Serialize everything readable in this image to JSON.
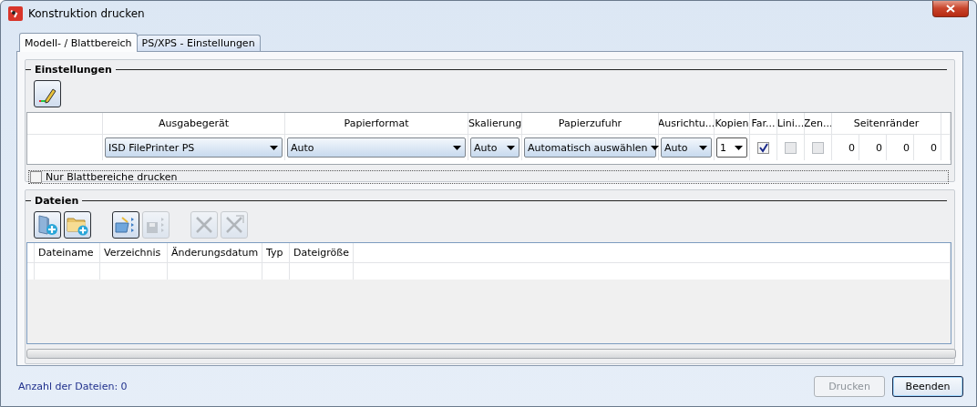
{
  "window": {
    "title": "Konstruktion drucken"
  },
  "tabs": [
    {
      "label": "Modell- / Blattbereich",
      "selected": true
    },
    {
      "label": "PS/XPS - Einstellungen",
      "selected": false
    }
  ],
  "settings": {
    "title": "Einstellungen",
    "columns": [
      "Ausgabegerät",
      "Papierformat",
      "Skalierung",
      "Papierzufuhr",
      "Ausrichtu...",
      "Kopien",
      "Far...",
      "Lini...",
      "Zen...",
      "Seitenränder"
    ],
    "cells": [
      {
        "kind": "dropdown",
        "value": "ISD FilePrinter PS"
      },
      {
        "kind": "dropdown",
        "value": "Auto"
      },
      {
        "kind": "dropdown",
        "value": "Auto"
      },
      {
        "kind": "dropdown",
        "value": "Automatisch auswählen"
      },
      {
        "kind": "dropdown",
        "value": "Auto"
      },
      {
        "kind": "combo",
        "value": "1"
      },
      {
        "kind": "checkbox",
        "checked": true,
        "disabled": false
      },
      {
        "kind": "checkbox",
        "checked": false,
        "disabled": true
      },
      {
        "kind": "checkbox",
        "checked": false,
        "disabled": true
      },
      {
        "kind": "number",
        "value": "0"
      },
      {
        "kind": "number",
        "value": "0"
      },
      {
        "kind": "number",
        "value": "0"
      },
      {
        "kind": "number",
        "value": "0"
      }
    ],
    "sheet_only": {
      "label": "Nur Blattbereiche drucken",
      "checked": false
    }
  },
  "files": {
    "title": "Dateien",
    "toolbar": [
      [
        {
          "kind": "add-file",
          "disabled": false
        },
        {
          "kind": "add-folder",
          "disabled": false
        }
      ],
      [
        {
          "kind": "open-list",
          "disabled": false
        },
        {
          "kind": "save-list",
          "disabled": true
        }
      ],
      [
        {
          "kind": "remove",
          "disabled": true
        },
        {
          "kind": "remove-all",
          "disabled": true
        }
      ]
    ],
    "columns": [
      "Dateiname",
      "Verzeichnis",
      "Änderungsdatum",
      "Typ",
      "Dateigröße"
    ]
  },
  "status": "Anzahl der Dateien: 0",
  "buttons": [
    {
      "label": "Drucken",
      "disabled": true,
      "default": false
    },
    {
      "label": "Beenden",
      "disabled": false,
      "default": true
    }
  ]
}
